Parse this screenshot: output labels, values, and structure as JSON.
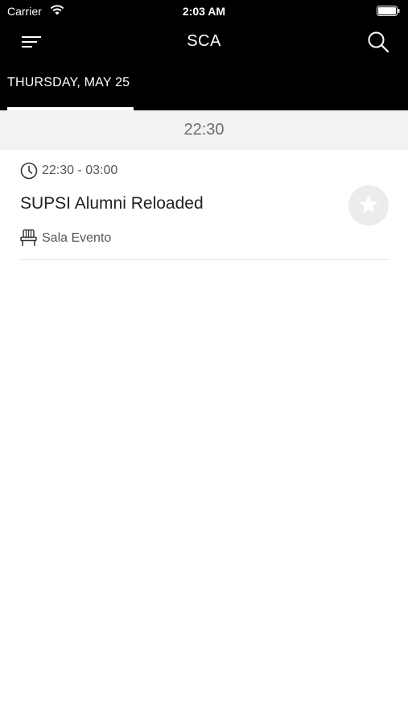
{
  "status_bar": {
    "carrier": "Carrier",
    "time": "2:03 AM"
  },
  "nav": {
    "title": "SCA",
    "menu_icon": "menu-icon",
    "search_icon": "search-icon"
  },
  "tabs": [
    {
      "label": "THURSDAY, MAY 25",
      "selected": true
    }
  ],
  "schedule": {
    "section_header": "22:30",
    "events": [
      {
        "time_range": "22:30 - 03:00",
        "title": "SUPSI Alumni Reloaded",
        "room": "Sala Evento",
        "favorite": false
      }
    ]
  },
  "colors": {
    "nav_background": "#000000",
    "section_background": "#f2f2f2",
    "favorite_button": "#ececec"
  }
}
